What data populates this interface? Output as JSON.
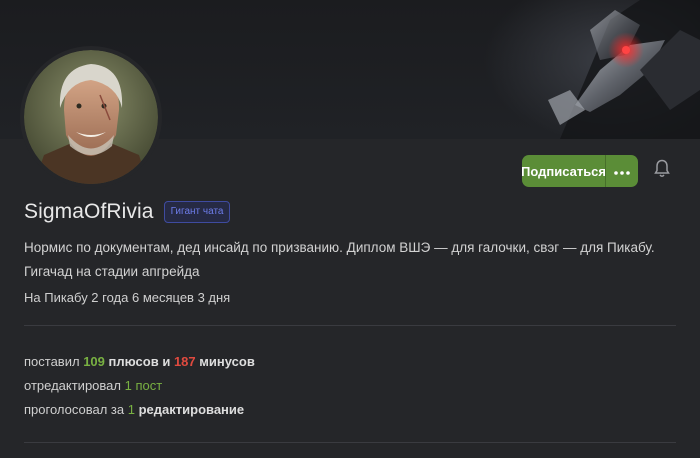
{
  "profile": {
    "username": "SigmaOfRivia",
    "badge": "Гигант чата",
    "bio": "Нормис по документам, дед инсайд по призванию. Диплом ВШЭ — для галочки, свэг — для Пикабу. Гигачад на стадии апгрейда",
    "since": "На Пикабу 2 года 6 месяцев 3 дня"
  },
  "actions": {
    "subscribe_label": "Подписаться",
    "more_icon": "more-dots-icon",
    "bell_icon": "bell-icon"
  },
  "stats": {
    "line1": {
      "prefix": "поставил",
      "plus_count": "109",
      "middle": "плюсов и",
      "minus_count": "187",
      "suffix": "минусов"
    },
    "line2": {
      "prefix": "отредактировал",
      "count": "1 пост"
    },
    "line3": {
      "prefix": "проголосовал за",
      "count": "1",
      "suffix": "редактирование"
    }
  },
  "colors": {
    "accent_green": "#5b8d37",
    "plus_green": "#79b142",
    "minus_red": "#e04a3f",
    "badge_blue": "#6d7ce9"
  }
}
